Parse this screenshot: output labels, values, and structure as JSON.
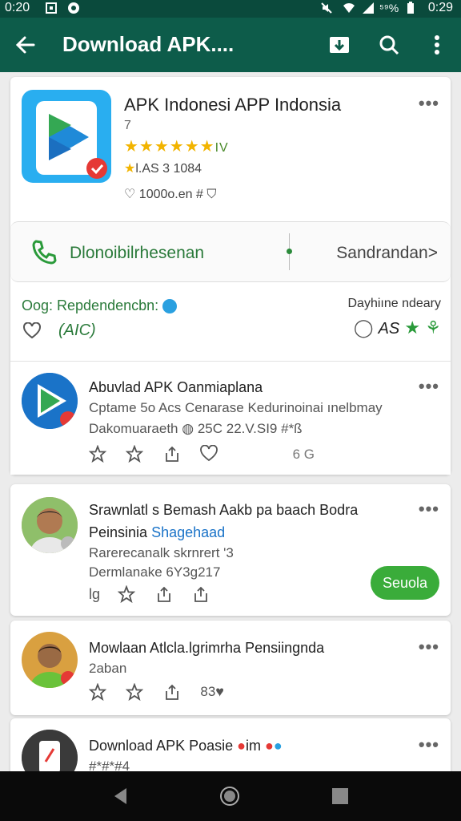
{
  "status_bar": {
    "time_left": "0:20",
    "time_right": "0:29",
    "signal_text": "⁵⁹%"
  },
  "app_bar": {
    "title": "Download APK...."
  },
  "app": {
    "title": "APK Indonesi APP Indonsia",
    "subtitle": "7",
    "stars": "★★★★★★",
    "stars_tail": "IV",
    "rating_text": "l.AS 3 1084",
    "likes_text": "1000o.en #",
    "download_label": "Dlonoibilrhesenan",
    "right_label": "Sandrandan>",
    "rec_label": "Oog: Repdendencbn:",
    "rec_right": "Dayhiıne ndeary",
    "count_green": "AIC)",
    "right_count": "AS"
  },
  "posts": [
    {
      "title": "Abuvlad APK Oanmiaplana",
      "line1": "Cptame 5o Acs Cenarase Kedurinoinai ınelbmay",
      "line2": "Dakomuaraeth",
      "line2_tail": "25C 22.V.SI9 #*ß",
      "count": "6 G"
    },
    {
      "title": "Srawnlatl s Bemash Aakb pa baach Bodra",
      "line1_a": "Peinsinia",
      "line1_b": "Shagehaad",
      "line2": "Rarerecanalk skrnrert '3",
      "line3": "Dermlanake 6Y3g217",
      "action_prefix": "lg",
      "follow_label": "Seuola"
    },
    {
      "title": "Mowlaan Atlcla.lgrimrha Pensiingnda",
      "line1": "2aban",
      "count": "83"
    },
    {
      "title": "Download APK Poasie",
      "title_tail": "im",
      "line1": "#*#*#4"
    }
  ],
  "colors": {
    "appbar": "#0d5c4a",
    "statusbar": "#0a4a3c",
    "green_text": "#2a7a3a",
    "follow_button": "#3aac3a",
    "star": "#f2b400",
    "link": "#1a73c8"
  }
}
